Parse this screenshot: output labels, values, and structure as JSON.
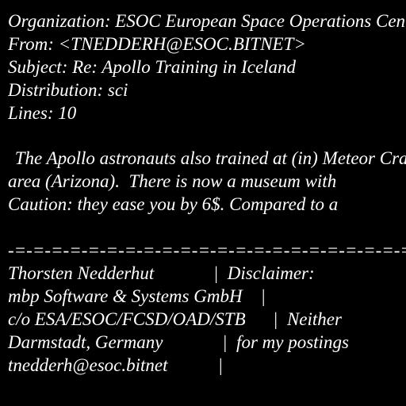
{
  "header": {
    "organization": "Organization: ESOC European Space Operations Centre",
    "from": "From: <TNEDDERH@ESOC.BITNET>",
    "subject": "Subject: Re: Apollo Training in Iceland",
    "distribution": "Distribution: sci",
    "lines": "Lines: 10"
  },
  "body": {
    "line1": " The Apollo astronauts also trained at (in) Meteor Crater",
    "line2": "area (Arizona).  There is now a museum with",
    "line3": "Caution: they ease you by 6$. Compared to a"
  },
  "signature": {
    "divider": "-=-=-=-=-=-=-=-=-=-=-=-=-=-=-=-=-=-=-=-=-=-=-=-=-=-=-=-=-=-",
    "line1": "Thorsten Nedderhut             |  Disclaimer:",
    "line2": "mbp Software & Systems GmbH    |",
    "line3": "c/o ESA/ESOC/FCSD/OAD/STB      |  Neither",
    "line4": "Darmstadt, Germany             |  for my postings",
    "line5": "tnedderh@esoc.bitnet           |"
  }
}
